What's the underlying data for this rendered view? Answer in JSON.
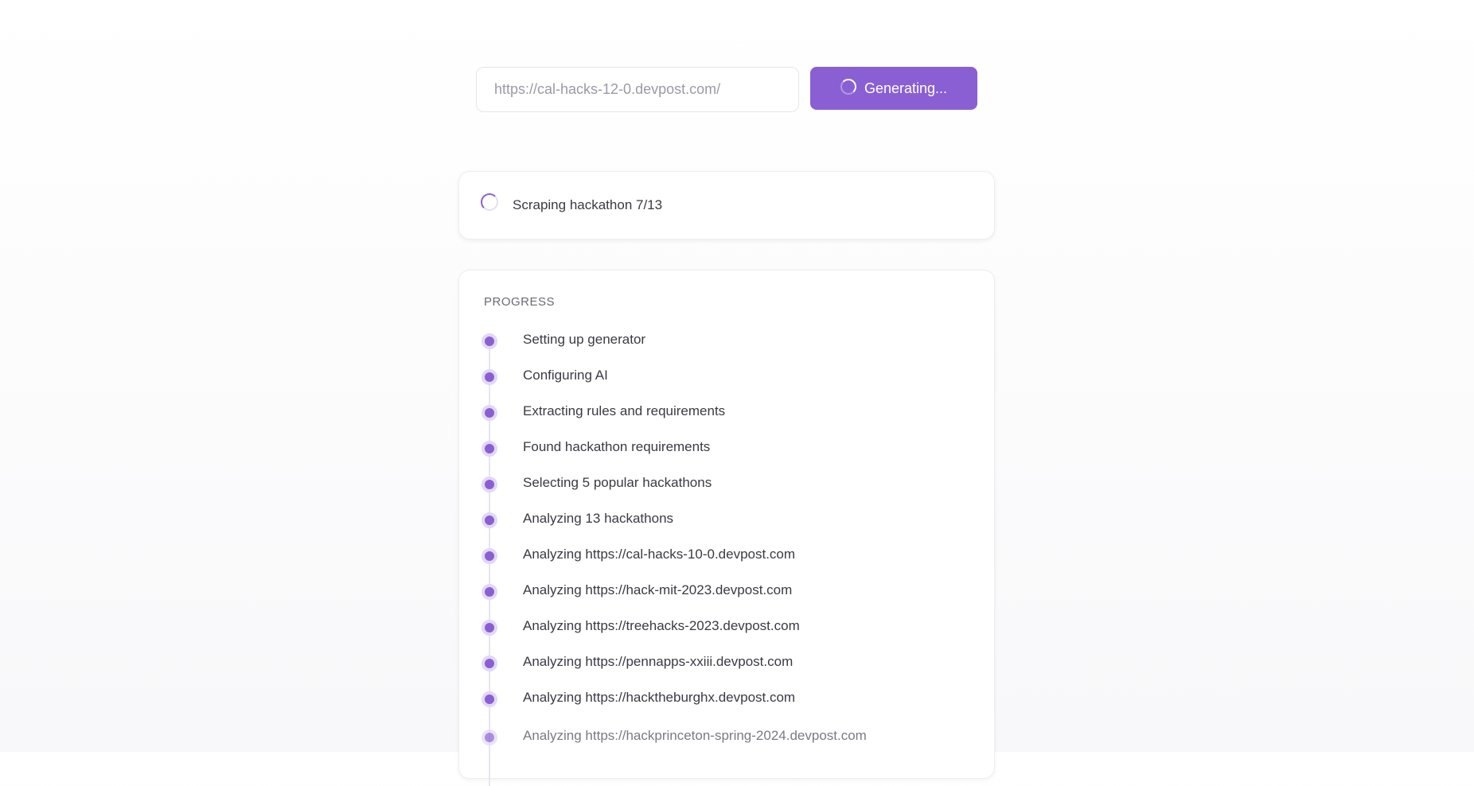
{
  "form": {
    "url_placeholder": "https://cal-hacks-12-0.devpost.com/",
    "generate_label": "Generating..."
  },
  "status": {
    "text": "Scraping hackathon 7/13"
  },
  "progress": {
    "title": "PROGRESS",
    "steps": [
      {
        "label": "Setting up generator"
      },
      {
        "label": "Configuring AI"
      },
      {
        "label": "Extracting rules and requirements"
      },
      {
        "label": "Found hackathon requirements"
      },
      {
        "label": "Selecting 5 popular hackathons"
      },
      {
        "label": "Analyzing 13 hackathons"
      },
      {
        "label": "Analyzing https://cal-hacks-10-0.devpost.com"
      },
      {
        "label": "Analyzing https://hack-mit-2023.devpost.com"
      },
      {
        "label": "Analyzing https://treehacks-2023.devpost.com"
      },
      {
        "label": "Analyzing https://pennapps-xxiii.devpost.com"
      },
      {
        "label": "Analyzing https://hacktheburghx.devpost.com"
      },
      {
        "label": "Analyzing https://hackprinceton-spring-2024.devpost.com"
      }
    ]
  },
  "colors": {
    "accent": "#8a5fd3",
    "accent_light": "#e2d8f4"
  }
}
